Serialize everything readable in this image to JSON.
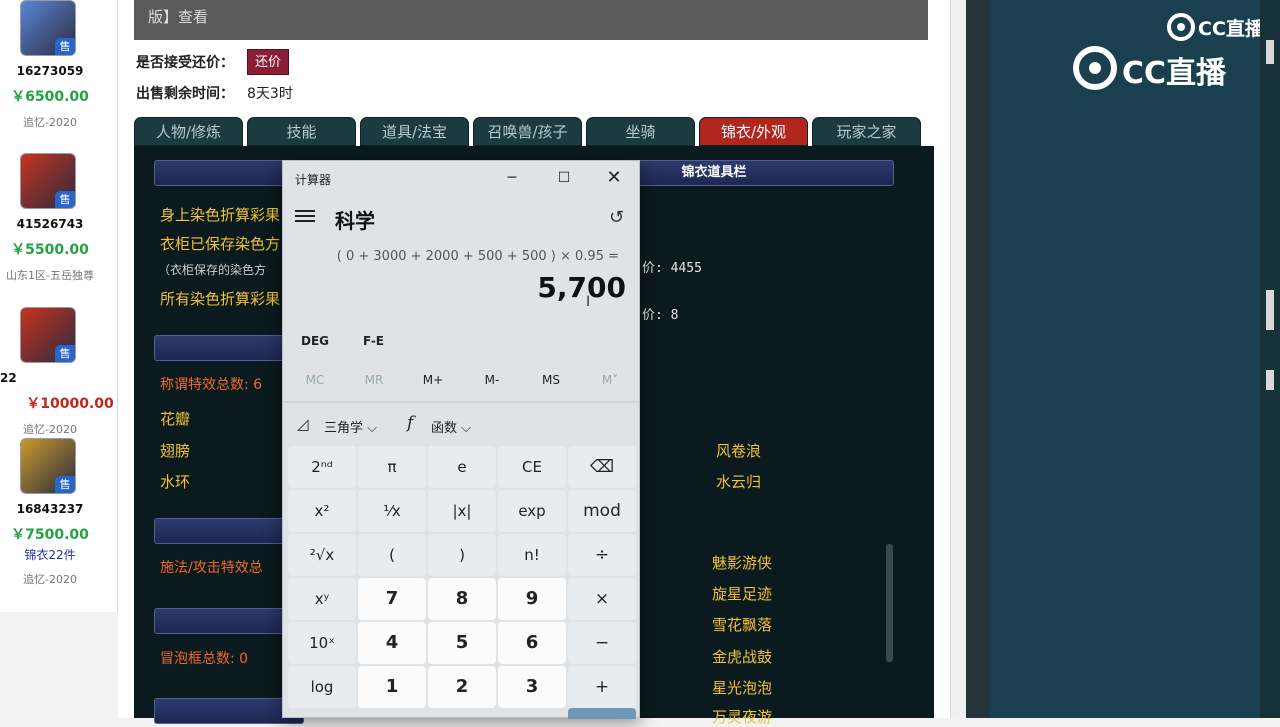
{
  "listings": [
    {
      "id": "16273059",
      "price": "￥6500.00",
      "server": "追忆-2020",
      "face": "blue"
    },
    {
      "id": "41526743",
      "price": "￥5500.00",
      "server": "山东1区-五岳独尊",
      "face": "red"
    },
    {
      "id": "22",
      "price": "￥10000.00",
      "server": "追忆-2020",
      "face": "red"
    },
    {
      "id": "16843237",
      "price": "￥7500.00",
      "extra": "锦衣22件",
      "server": "追忆-2020",
      "face": "gold"
    }
  ],
  "badge": "售",
  "header": {
    "top_text": "版】查看",
    "accept_label": "是否接受还价：",
    "counter_button": "还价",
    "time_label": "出售剩余时间：",
    "time_value": "8天3时"
  },
  "tabs": [
    "人物/修炼",
    "技能",
    "道具/法宝",
    "召唤兽/孩子",
    "坐骑",
    "锦衣/外观",
    "玩家之家"
  ],
  "active_tab": "锦衣/外观",
  "panel": {
    "section_title": "锦衣道具栏",
    "dye_lines": [
      "身上染色折算彩果",
      "衣柜已保存染色方",
      "（衣柜保存的染色方",
      "所有染色折算彩果"
    ],
    "right_values": [
      "价: 4455",
      "价: 8"
    ],
    "title_effects": "称谓特效总数: 6",
    "effects_left": [
      "花瓣",
      "翅膀",
      "水环"
    ],
    "effects_right": [
      "风卷浪",
      "水云归"
    ],
    "skill_effects": "施法/攻击特效总",
    "skill_right": [
      "魅影游侠",
      "旋星足迹",
      "雪花飘落",
      "金虎战鼓",
      "星光泡泡",
      "万灵夜游"
    ],
    "bubble": "冒泡框总数: 0"
  },
  "calculator": {
    "title": "计算器",
    "mode": "科学",
    "expression": "( 0 + 3000 + 2000 + 500 + 500 ) × 0.95 =",
    "result": "5,700",
    "angle": "DEG",
    "fe": "F-E",
    "memory": [
      "MC",
      "MR",
      "M+",
      "M-",
      "MS",
      "M˅"
    ],
    "trig": "三角学",
    "func": "函数",
    "keys": [
      [
        "2ⁿᵈ",
        "π",
        "e",
        "CE",
        "⌫"
      ],
      [
        "x²",
        "¹⁄x",
        "|x|",
        "exp",
        "mod"
      ],
      [
        "²√x",
        "(",
        ")",
        "n!",
        "÷"
      ],
      [
        "xʸ",
        "7",
        "8",
        "9",
        "×"
      ],
      [
        "10ˣ",
        "4",
        "5",
        "6",
        "−"
      ],
      [
        "log",
        "1",
        "2",
        "3",
        "+"
      ]
    ]
  },
  "logos": {
    "small": "CC直播",
    "big": "CC直播"
  }
}
